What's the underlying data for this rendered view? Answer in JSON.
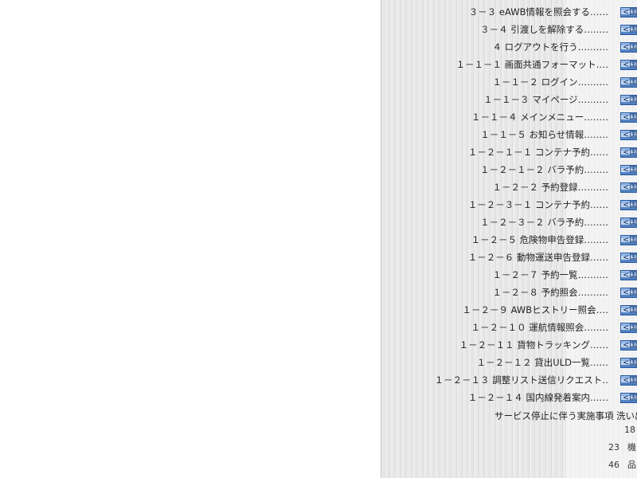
{
  "toc": {
    "items": [
      {
        "label": "３－３ eAWB情報を照会する‥‥‥",
        "icon": "link-icon"
      },
      {
        "label": "３－４ 引渡しを解除する‥‥‥‥",
        "icon": "link-icon"
      },
      {
        "label": "４ ログアウトを行う‥‥‥‥‥",
        "icon": "link-icon"
      },
      {
        "label": "１－１－１ 画面共通フォーマット‥‥",
        "icon": "link-icon"
      },
      {
        "label": "１－１－２ ログイン‥‥‥‥‥",
        "icon": "link-icon"
      },
      {
        "label": "１－１－３ マイページ‥‥‥‥‥",
        "icon": "link-icon"
      },
      {
        "label": "１－１－４ メインメニュー‥‥‥‥",
        "icon": "link-icon"
      },
      {
        "label": "１－１－５ お知らせ情報‥‥‥‥",
        "icon": "link-icon"
      },
      {
        "label": "１－２－１－１ コンテナ予約‥‥‥",
        "icon": "link-icon"
      },
      {
        "label": "１－２－１－２ バラ予約‥‥‥‥",
        "icon": "link-icon"
      },
      {
        "label": "１－２－２ 予約登録‥‥‥‥‥",
        "icon": "link-icon"
      },
      {
        "label": "１－２－３－１ コンテナ予約‥‥‥",
        "icon": "link-icon"
      },
      {
        "label": "１－２－３－２ バラ予約‥‥‥‥",
        "icon": "link-icon"
      },
      {
        "label": "１－２－５ 危険物申告登録‥‥‥‥",
        "icon": "link-icon"
      },
      {
        "label": "１－２－６ 動物運送申告登録‥‥‥",
        "icon": "link-icon"
      },
      {
        "label": "１－２－７ 予約一覧‥‥‥‥‥",
        "icon": "link-icon"
      },
      {
        "label": "１－２－８ 予約照会‥‥‥‥‥",
        "icon": "link-icon"
      },
      {
        "label": "１－２－９ AWBヒストリー照会‥‥",
        "icon": "link-icon"
      },
      {
        "label": "１－２－１０ 運航情報照会‥‥‥‥",
        "icon": "link-icon"
      },
      {
        "label": "１－２－１１ 貨物トラッキング‥‥‥",
        "icon": "link-icon"
      },
      {
        "label": "１－２－１２ 貸出ULD一覧‥‥‥",
        "icon": "link-icon"
      },
      {
        "label": "１－２－１３ 調整リスト送信リクエスト‥",
        "icon": "link-icon"
      },
      {
        "label": "１－２－１４ 国内線発着案内‥‥‥",
        "icon": "link-icon"
      }
    ],
    "icon_glyph": "<国"
  },
  "tail": {
    "title": "サービス停止に伴う実施事項 洗い出",
    "rows": [
      {
        "num": "18",
        "label": ""
      },
      {
        "num": "23",
        "label": "機"
      },
      {
        "num": "46",
        "label": "品"
      }
    ]
  },
  "colors": {
    "icon_border": "#2c5aa0",
    "icon_fill": "#6d98d1",
    "panel_bg": "#e7e7e7",
    "text": "#222222"
  }
}
